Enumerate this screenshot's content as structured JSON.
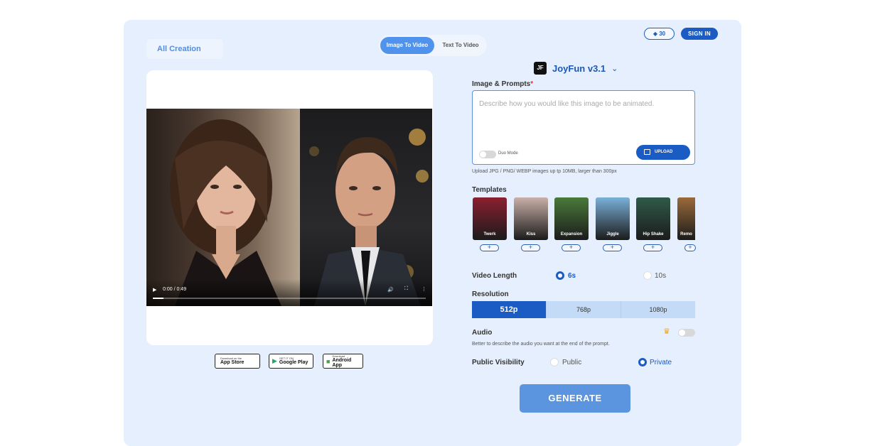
{
  "sidebar": {
    "all_creation": "All Creation"
  },
  "modes": {
    "image_to_video": "Image To Video",
    "text_to_video": "Text To Video"
  },
  "header": {
    "credits_icon": "diamond-icon",
    "credits": "30",
    "sign_in": "SIGN IN"
  },
  "model": {
    "logo": "JF",
    "name": "JoyFun v3.1"
  },
  "video": {
    "time": "0:00 / 0:49",
    "progress": 0.04
  },
  "stores": [
    {
      "icon": "apple-icon",
      "small": "Download on the",
      "big": "App Store"
    },
    {
      "icon": "google-play-icon",
      "small": "GET IT ON",
      "big": "Google Play"
    },
    {
      "icon": "android-icon",
      "small": "Download",
      "big": "Android App"
    }
  ],
  "prompt": {
    "label": "Image & Prompts",
    "required_mark": "*",
    "placeholder": "Describe how you would like this image to be animated.",
    "duo_mode": "Duo Mode",
    "upload": "UPLOAD",
    "hint": "Upload JPG / PNG/ WEBP images up tp 10MB, larger than 300px"
  },
  "templates": {
    "label": "Templates",
    "items": [
      {
        "label": "Twerk",
        "color": "#8a2030"
      },
      {
        "label": "Kiss",
        "color": "#c9b0a8"
      },
      {
        "label": "Expansion",
        "color": "#4a7a3a"
      },
      {
        "label": "Jiggle",
        "color": "#7ab0d8"
      },
      {
        "label": "Hip Shake",
        "color": "#2f5a4a"
      },
      {
        "label": "Remo",
        "color": "#9a6a3a"
      }
    ]
  },
  "video_length": {
    "label": "Video Length",
    "options": [
      "6s",
      "10s"
    ],
    "selected": "6s"
  },
  "resolution": {
    "label": "Resolution",
    "options": [
      "512p",
      "768p",
      "1080p"
    ],
    "selected": "512p"
  },
  "audio": {
    "label": "Audio",
    "hint": "Better to describe the audio you want at the end of the prompt.",
    "enabled": false
  },
  "visibility": {
    "label": "Public Visibility",
    "options": [
      "Public",
      "Private"
    ],
    "selected": "Private"
  },
  "generate": "GENERATE",
  "colors": {
    "accent": "#1a5bc4",
    "panel": "#e6effd",
    "generate": "#5b95e0"
  }
}
